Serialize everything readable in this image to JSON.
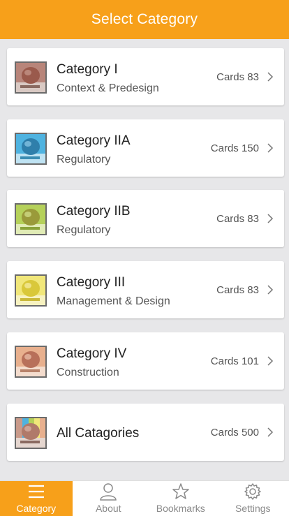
{
  "header": {
    "title": "Select Category"
  },
  "colors": {
    "accent": "#f7a01a",
    "background": "#e7e7e9"
  },
  "categories": [
    {
      "title": "Category I",
      "subtitle": "Context & Predesign",
      "cards": "Cards 83",
      "icon": "category-i-thumbnail",
      "color": "#b8857a"
    },
    {
      "title": "Category IIA",
      "subtitle": "Regulatory",
      "cards": "Cards 150",
      "icon": "category-iia-thumbnail",
      "color": "#4fb3e0"
    },
    {
      "title": "Category IIB",
      "subtitle": "Regulatory",
      "cards": "Cards 83",
      "icon": "category-iib-thumbnail",
      "color": "#b5d15a"
    },
    {
      "title": "Category III",
      "subtitle": "Management & Design",
      "cards": "Cards 83",
      "icon": "category-iii-thumbnail",
      "color": "#f1e77a"
    },
    {
      "title": "Category IV",
      "subtitle": "Construction",
      "cards": "Cards 101",
      "icon": "category-iv-thumbnail",
      "color": "#e8b08e"
    },
    {
      "title": "All Catagories",
      "subtitle": "",
      "cards": "Cards 500",
      "icon": "all-categories-thumbnail",
      "color": "#c99a8a"
    }
  ],
  "tabs": [
    {
      "label": "Category",
      "icon": "menu-icon",
      "active": true
    },
    {
      "label": "About",
      "icon": "person-icon",
      "active": false
    },
    {
      "label": "Bookmarks",
      "icon": "star-icon",
      "active": false
    },
    {
      "label": "Settings",
      "icon": "gear-icon",
      "active": false
    }
  ]
}
